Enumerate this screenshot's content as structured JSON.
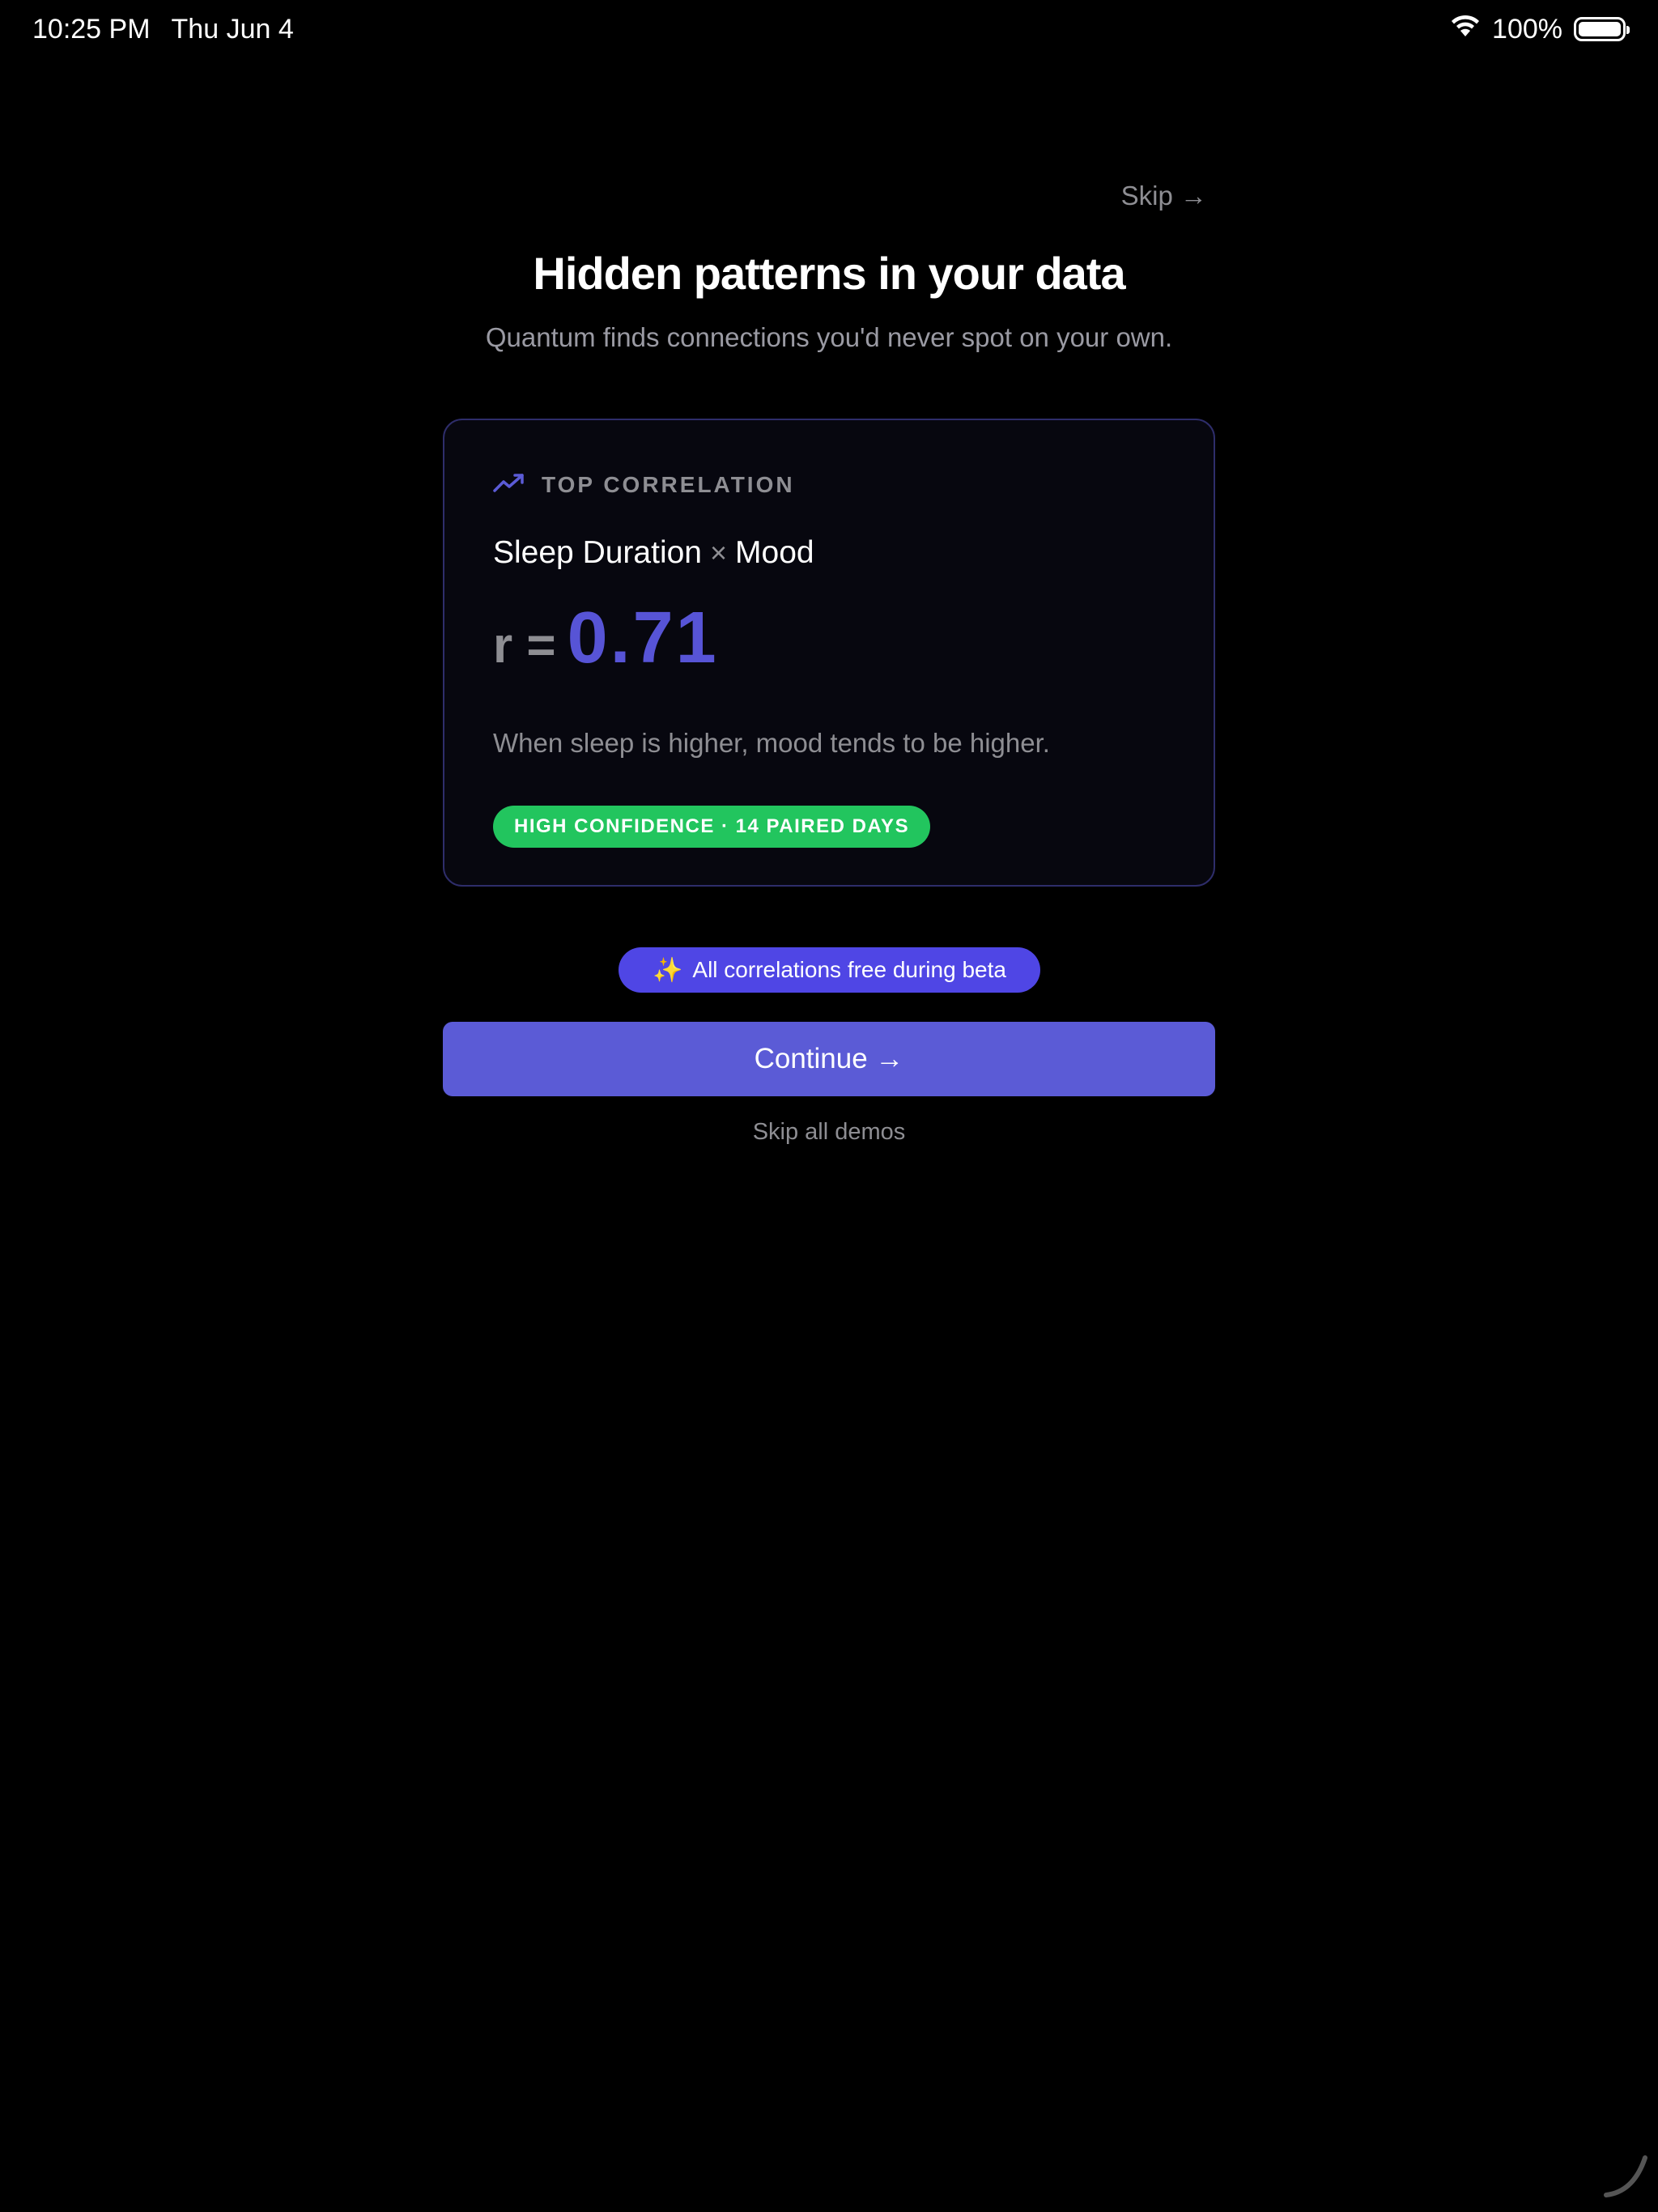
{
  "status_bar": {
    "time": "10:25 PM",
    "date": "Thu Jun 4",
    "battery": "100%"
  },
  "header": {
    "skip_label": "Skip →",
    "title": "Hidden patterns in your data",
    "subtitle": "Quantum finds connections you'd never spot on your own."
  },
  "card": {
    "label": "TOP CORRELATION",
    "variable_a": "Sleep Duration",
    "times": "×",
    "variable_b": "Mood",
    "r_prefix": "r =",
    "r_value": "0.71",
    "description": "When sleep is higher, mood tends to be higher.",
    "badge": "HIGH CONFIDENCE · 14 PAIRED DAYS"
  },
  "beta_pill": {
    "icon": "✨",
    "label": "All correlations free during beta"
  },
  "actions": {
    "continue_label": "Continue →",
    "skip_all_label": "Skip all demos"
  },
  "colors": {
    "accent": "#5b5bd6",
    "success": "#22c55e",
    "background": "#000000"
  }
}
